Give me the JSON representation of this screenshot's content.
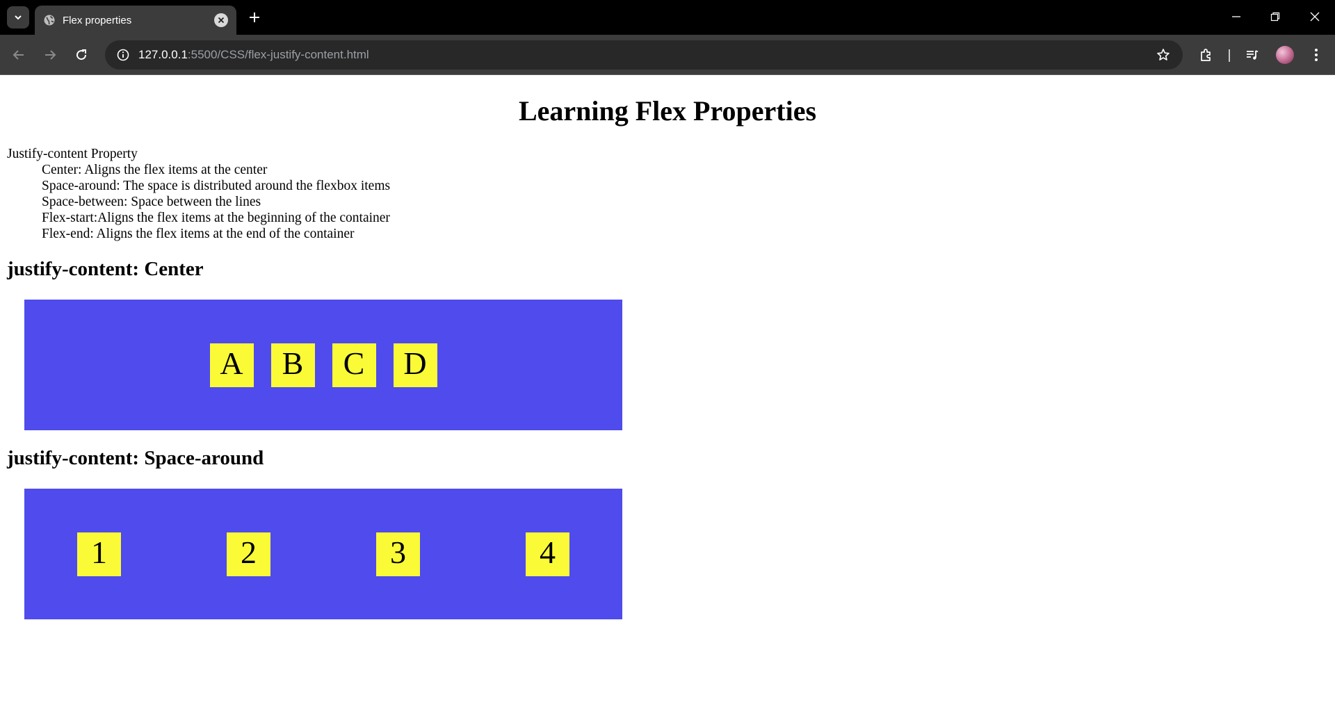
{
  "browser": {
    "tab_title": "Flex properties",
    "url_host": "127.0.0.1",
    "url_rest": ":5500/CSS/flex-justify-content.html",
    "icons": [
      "tab-search-icon",
      "globe-icon",
      "close-icon",
      "plus-icon",
      "minimize-icon",
      "restore-icon",
      "window-close-icon",
      "back-arrow-icon",
      "forward-arrow-icon",
      "reload-icon",
      "info-icon",
      "star-icon",
      "extensions-icon",
      "media-control-icon",
      "kebab-menu-icon"
    ]
  },
  "page": {
    "title": "Learning Flex Properties",
    "intro_heading": "Justify-content Property",
    "intro_items": [
      "Center: Aligns the flex items at the center",
      "Space-around: The space is distributed around the flexbox items",
      "Space-between: Space between the lines",
      "Flex-start:Aligns the flex items at the beginning of the container",
      "Flex-end: Aligns the flex items at the end of the container"
    ],
    "sections": [
      {
        "heading": "justify-content: Center",
        "items": [
          "A",
          "B",
          "C",
          "D"
        ]
      },
      {
        "heading": "justify-content: Space-around",
        "items": [
          "1",
          "2",
          "3",
          "4"
        ]
      }
    ],
    "colors": {
      "container": "#4f4bec",
      "item": "#fafa37"
    }
  }
}
